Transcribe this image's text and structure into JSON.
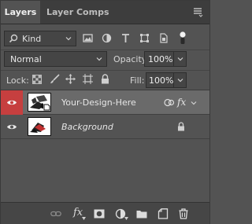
{
  "tabs": [
    {
      "label": "Layers",
      "active": true
    },
    {
      "label": "Layer Comps",
      "active": false
    }
  ],
  "filter": {
    "kind_label": "Kind",
    "icons": [
      "pixel-filter-icon",
      "adjustment-filter-icon",
      "type-filter-icon",
      "shape-filter-icon",
      "smart-object-filter-icon",
      "filter-toggle-icon"
    ]
  },
  "blend": {
    "mode": "Normal",
    "opacity_label": "Opacity:",
    "opacity_value": "100%"
  },
  "lock": {
    "label": "Lock:",
    "fill_label": "Fill:",
    "fill_value": "100%"
  },
  "layers": [
    {
      "name": "Your-Design-Here",
      "selected": true,
      "italic": false,
      "badges": [
        "smart-object-icon",
        "fx"
      ]
    },
    {
      "name": "Background",
      "selected": false,
      "italic": true,
      "badges": [
        "lock-icon"
      ]
    }
  ],
  "layer_fx_label": "fx",
  "bottom": {
    "fx_label": "fx"
  },
  "colors": {
    "panel_bg": "#535353",
    "selected_row": "#6a6a6a",
    "eye_highlight": "#c63f3f"
  }
}
